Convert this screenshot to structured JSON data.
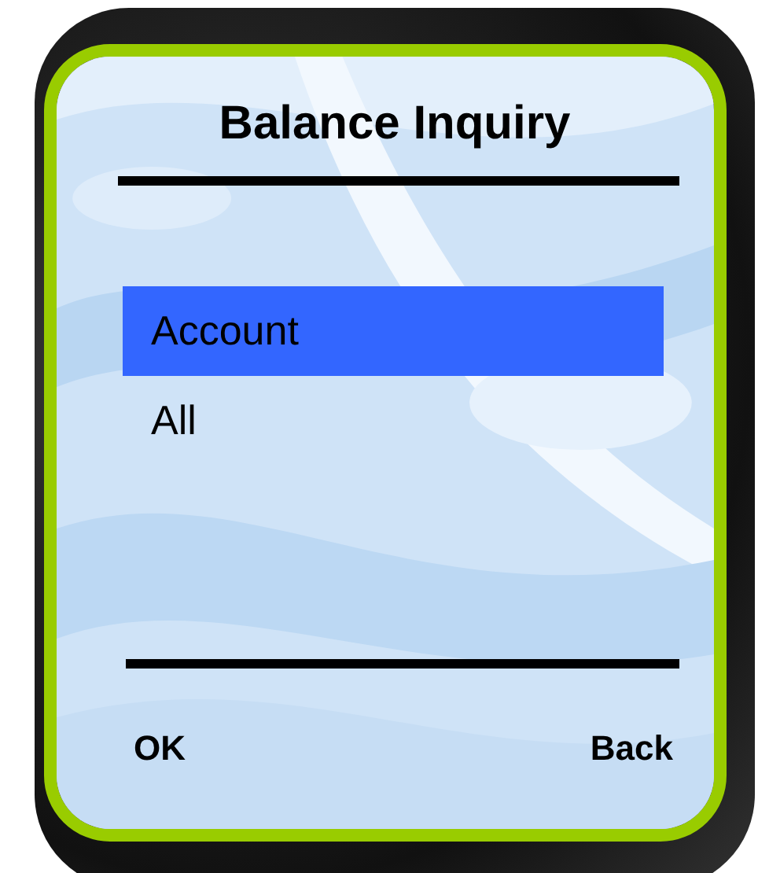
{
  "title": "Balance Inquiry",
  "menu": [
    {
      "label": "Account",
      "selected": true
    },
    {
      "label": "All",
      "selected": false
    }
  ],
  "softkeys": {
    "left": "OK",
    "right": "Back"
  }
}
